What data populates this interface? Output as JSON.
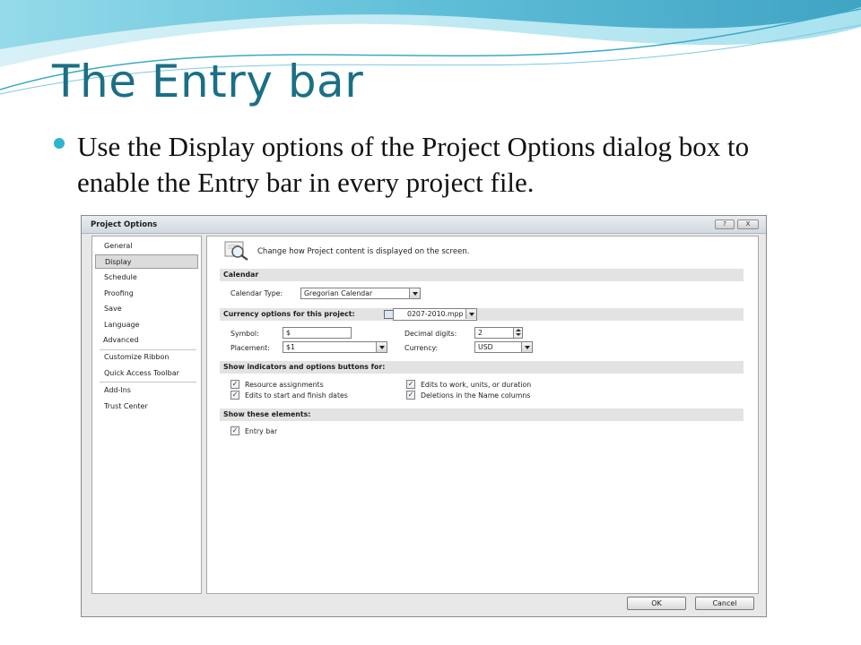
{
  "slide": {
    "title": "The Entry bar",
    "bullet": "Use the Display options of the Project Options dialog box to enable the Entry bar in every project file."
  },
  "dialog": {
    "title": "Project Options",
    "window_buttons": [
      "?",
      "X"
    ],
    "nav": [
      {
        "label": "General",
        "selected": false
      },
      {
        "label": "Display",
        "selected": true
      },
      {
        "label": "Schedule",
        "selected": false
      },
      {
        "label": "Proofing",
        "selected": false
      },
      {
        "label": "Save",
        "selected": false
      },
      {
        "label": "Language",
        "selected": false
      },
      {
        "label": "Advanced",
        "selected": false
      },
      {
        "label": "Customize Ribbon",
        "selected": false
      },
      {
        "label": "Quick Access Toolbar",
        "selected": false
      },
      {
        "label": "Add-Ins",
        "selected": false
      },
      {
        "label": "Trust Center",
        "selected": false
      }
    ],
    "intro": "Change how Project content is displayed on the screen.",
    "calendar": {
      "header": "Calendar",
      "type_label": "Calendar Type:",
      "type_value": "Gregorian Calendar"
    },
    "currency": {
      "header": "Currency options for this project:",
      "project": "0207-2010.mpp",
      "symbol_label": "Symbol:",
      "symbol_value": "$",
      "decimal_label": "Decimal digits:",
      "decimal_value": "2",
      "placement_label": "Placement:",
      "placement_value": "$1",
      "currency_label": "Currency:",
      "currency_value": "USD"
    },
    "indicators": {
      "header": "Show indicators and options buttons for:",
      "items": [
        {
          "label": "Resource assignments",
          "checked": true
        },
        {
          "label": "Edits to work, units, or duration",
          "checked": true
        },
        {
          "label": "Edits to start and finish dates",
          "checked": true
        },
        {
          "label": "Deletions in the Name columns",
          "checked": true
        }
      ]
    },
    "elements": {
      "header": "Show these elements:",
      "entry_bar_label": "Entry bar",
      "entry_bar_checked": true
    },
    "ok_label": "OK",
    "cancel_label": "Cancel",
    "check_glyph": "✓"
  },
  "colors": {
    "title": "#1b6f86",
    "bullet": "#2eb5cf"
  }
}
